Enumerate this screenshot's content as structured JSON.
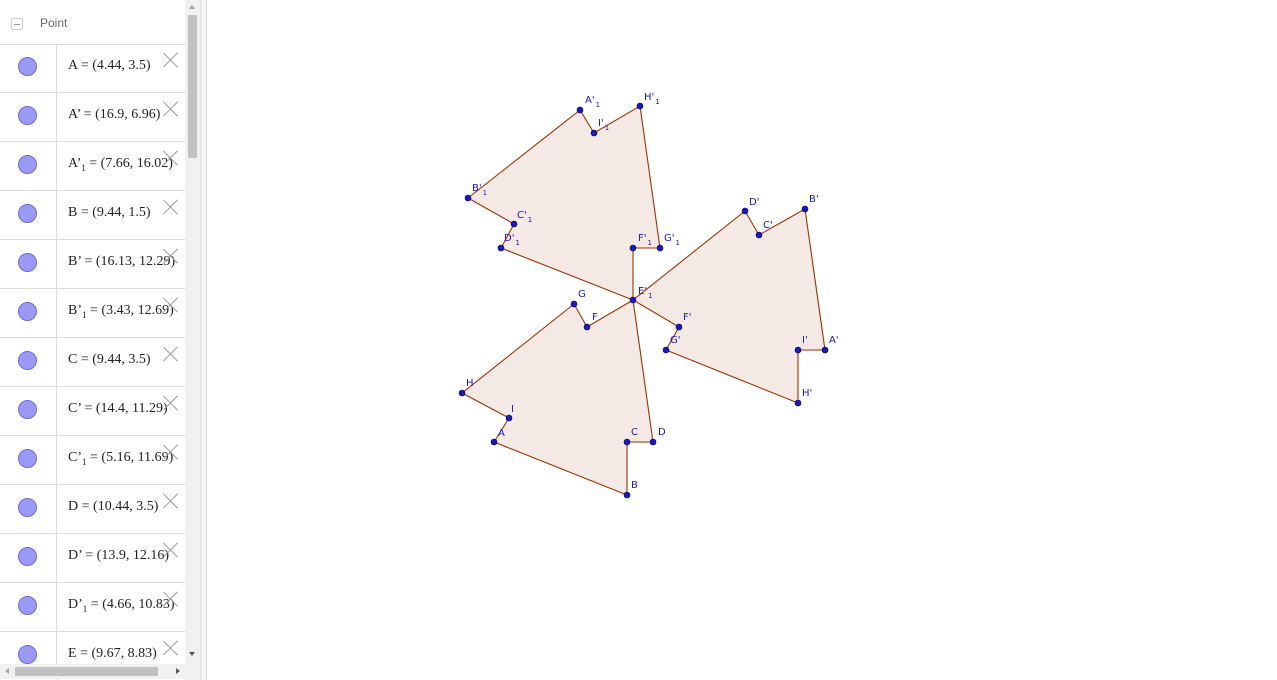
{
  "algebra": {
    "group_title": "Point",
    "rows": [
      {
        "name": "A",
        "sub": "",
        "prime": false,
        "value": "(4.44, 3.5)"
      },
      {
        "name": "A",
        "sub": "",
        "prime": true,
        "value": "(16.9, 6.96)"
      },
      {
        "name": "A",
        "sub": "1",
        "prime": true,
        "value": "(7.66, 16.02)"
      },
      {
        "name": "B",
        "sub": "",
        "prime": false,
        "value": "(9.44, 1.5)"
      },
      {
        "name": "B",
        "sub": "",
        "prime": true,
        "value": "(16.13, 12.29)"
      },
      {
        "name": "B",
        "sub": "1",
        "prime": true,
        "value": "(3.43, 12.69)"
      },
      {
        "name": "C",
        "sub": "",
        "prime": false,
        "value": "(9.44, 3.5)"
      },
      {
        "name": "C",
        "sub": "",
        "prime": true,
        "value": "(14.4, 11.29)"
      },
      {
        "name": "C",
        "sub": "1",
        "prime": true,
        "value": "(5.16, 11.69)"
      },
      {
        "name": "D",
        "sub": "",
        "prime": false,
        "value": "(10.44, 3.5)"
      },
      {
        "name": "D",
        "sub": "",
        "prime": true,
        "value": "(13.9, 12.16)"
      },
      {
        "name": "D",
        "sub": "1",
        "prime": true,
        "value": "(4.66, 10.83)"
      },
      {
        "name": "E",
        "sub": "",
        "prime": false,
        "value": "(9.67, 8.83)"
      }
    ]
  },
  "graphics": {
    "colors": {
      "fill": "#f5e9e6",
      "stroke": "#993300",
      "point": "#1a1ab5"
    },
    "labels": {
      "A": "A",
      "B": "B",
      "C": "C",
      "D": "D",
      "F": "F",
      "G": "G",
      "H": "H",
      "I": "I",
      "A_p": "A'",
      "B_p": "B'",
      "C_p": "C'",
      "D_p": "D'",
      "F_p": "F'",
      "G_p": "G'",
      "H_p": "H'",
      "I_p": "I'",
      "A_p1": "A'",
      "B_p1": "B'",
      "C_p1": "C'",
      "D_p1": "D'",
      "E_p1": "E'",
      "F_p1": "F'",
      "G_p1": "G'",
      "H_p1": "H'",
      "I_p1": "I'",
      "subscript": "1"
    }
  }
}
